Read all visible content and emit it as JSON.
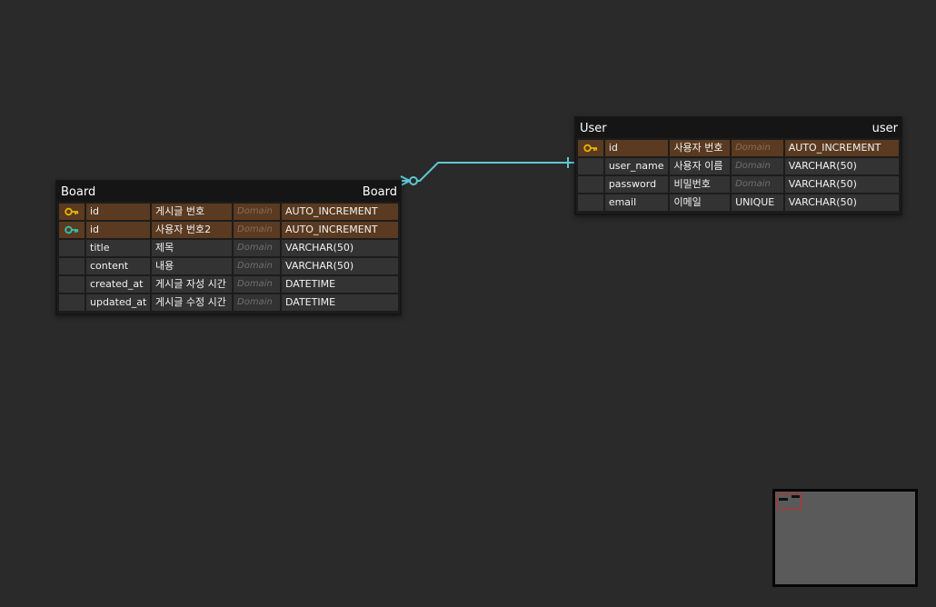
{
  "tables": {
    "board": {
      "logical_name": "Board",
      "physical_name": "Board",
      "rows": [
        {
          "key": "pk",
          "name": "id",
          "comment": "게시글 번호",
          "domain": "Domain",
          "type": "AUTO_INCREMENT"
        },
        {
          "key": "fk",
          "name": "id",
          "comment": "사용자 번호2",
          "domain": "Domain",
          "type": "AUTO_INCREMENT"
        },
        {
          "key": "",
          "name": "title",
          "comment": "제목",
          "domain": "Domain",
          "type": "VARCHAR(50)"
        },
        {
          "key": "",
          "name": "content",
          "comment": "내용",
          "domain": "Domain",
          "type": "VARCHAR(50)"
        },
        {
          "key": "",
          "name": "created_at",
          "comment": "게시글 자성 시간",
          "domain": "Domain",
          "type": "DATETIME"
        },
        {
          "key": "",
          "name": "updated_at",
          "comment": "게시글 수정 시간",
          "domain": "Domain",
          "type": "DATETIME"
        }
      ]
    },
    "user": {
      "logical_name": "User",
      "physical_name": "user",
      "rows": [
        {
          "key": "pk",
          "name": "id",
          "comment": "사용자 번호",
          "domain": "Domain",
          "type": "AUTO_INCREMENT"
        },
        {
          "key": "",
          "name": "user_name",
          "comment": "사용자 이름",
          "domain": "Domain",
          "type": "VARCHAR(50)"
        },
        {
          "key": "",
          "name": "password",
          "comment": "비밀번호",
          "domain": "Domain",
          "type": "VARCHAR(50)"
        },
        {
          "key": "",
          "name": "email",
          "comment": "이메일",
          "domain": "UNIQUE",
          "type": "VARCHAR(50)"
        }
      ]
    }
  },
  "relationship": {
    "from": "Board",
    "to": "User",
    "from_cardinality": "zero-or-many",
    "to_cardinality": "exactly-one",
    "color": "#5fc7d4"
  },
  "colors": {
    "canvas": "#2a2a2a",
    "pk_key": "#e6b400",
    "fk_key": "#2fc4b2",
    "key_row": "#5a3a20"
  },
  "icons": {
    "pk": "primary-key-icon",
    "fk": "foreign-key-icon"
  }
}
